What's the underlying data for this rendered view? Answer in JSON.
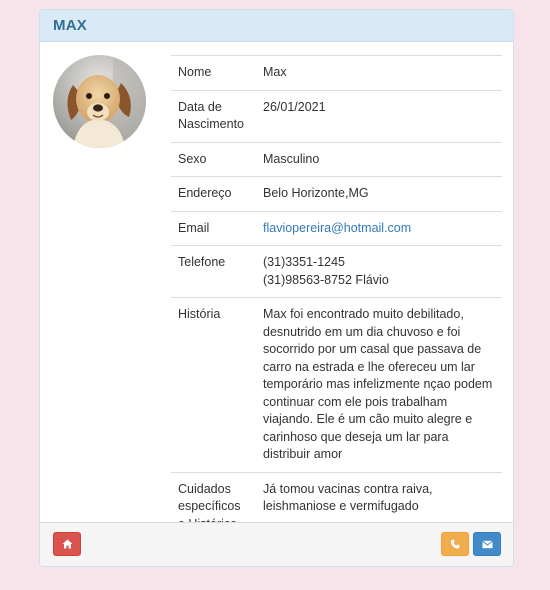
{
  "panel": {
    "title": "MAX"
  },
  "details": [
    {
      "label": "Nome",
      "value": "Max"
    },
    {
      "label": "Data de Nascimento",
      "value": "26/01/2021"
    },
    {
      "label": "Sexo",
      "value": "Masculino"
    },
    {
      "label": "Endereço",
      "value": "Belo Horizonte,MG"
    },
    {
      "label": "Email",
      "value": "flaviopereira@hotmail.com"
    },
    {
      "label": "Telefone",
      "value": "(31)3351-1245\n(31)98563-8752 Flávio"
    },
    {
      "label": "História",
      "value": "Max foi encontrado muito debilitado, desnutrido em um dia chuvoso e foi socorrido por um casal que passava de carro na estrada e lhe ofereceu um lar temporário mas infelizmente nçao podem continuar com ele pois trabalham viajando. Ele é um cão muito alegre e carinhoso que deseja um lar para distribuir amor"
    },
    {
      "label": "Cuidados específicos e Histórico",
      "value": "Já tomou vacinas contra raiva, leishmaniose e vermifugado"
    }
  ],
  "footer": {
    "home_icon": "home-icon",
    "phone_icon": "phone-icon",
    "mail_icon": "envelope-icon"
  },
  "colors": {
    "background": "#f6e4ea",
    "heading_bg": "#d9eaf6",
    "title": "#31708f",
    "link": "#337ab7",
    "danger": "#d9534f",
    "warning": "#f0ad4e",
    "primary": "#428bca"
  }
}
